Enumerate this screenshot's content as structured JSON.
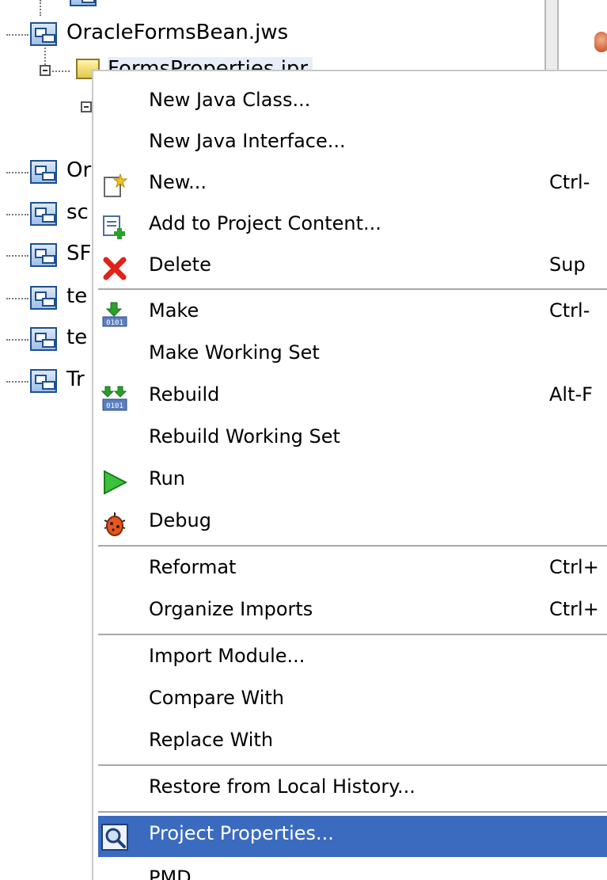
{
  "tree": {
    "items": [
      {
        "label": "OracleFormsBean.jws"
      },
      {
        "label": "FormsProperties.jpr"
      },
      {
        "label": "Or"
      },
      {
        "label": "sc"
      },
      {
        "label": "SF"
      },
      {
        "label": "te"
      },
      {
        "label": "te"
      },
      {
        "label": "Tr"
      }
    ]
  },
  "context_menu": {
    "items": [
      {
        "label": "New Java Class...",
        "accelerator": "",
        "icon": ""
      },
      {
        "label": "New Java Interface...",
        "accelerator": "",
        "icon": ""
      },
      {
        "label": "New...",
        "accelerator": "Ctrl-",
        "icon": "new-icon"
      },
      {
        "label": "Add to Project Content...",
        "accelerator": "",
        "icon": "add-content-icon"
      },
      {
        "label": "Delete",
        "accelerator": "Sup",
        "icon": "delete-icon"
      },
      {
        "label": "Make",
        "accelerator": "Ctrl-",
        "icon": "make-icon"
      },
      {
        "label": "Make Working Set",
        "accelerator": "",
        "icon": ""
      },
      {
        "label": "Rebuild",
        "accelerator": "Alt-F",
        "icon": "rebuild-icon"
      },
      {
        "label": "Rebuild Working Set",
        "accelerator": "",
        "icon": ""
      },
      {
        "label": "Run",
        "accelerator": "",
        "icon": "run-icon"
      },
      {
        "label": "Debug",
        "accelerator": "",
        "icon": "debug-icon"
      },
      {
        "label": "Reformat",
        "accelerator": "Ctrl+",
        "icon": ""
      },
      {
        "label": "Organize Imports",
        "accelerator": "Ctrl+",
        "icon": ""
      },
      {
        "label": "Import Module...",
        "accelerator": "",
        "icon": ""
      },
      {
        "label": "Compare With",
        "accelerator": "",
        "icon": ""
      },
      {
        "label": "Replace With",
        "accelerator": "",
        "icon": ""
      },
      {
        "label": "Restore from Local History...",
        "accelerator": "",
        "icon": ""
      },
      {
        "label": "Project Properties...",
        "accelerator": "",
        "icon": "project-properties-icon"
      },
      {
        "label": "PMD",
        "accelerator": "",
        "icon": ""
      }
    ],
    "highlight_color": "#3a6bbf"
  }
}
